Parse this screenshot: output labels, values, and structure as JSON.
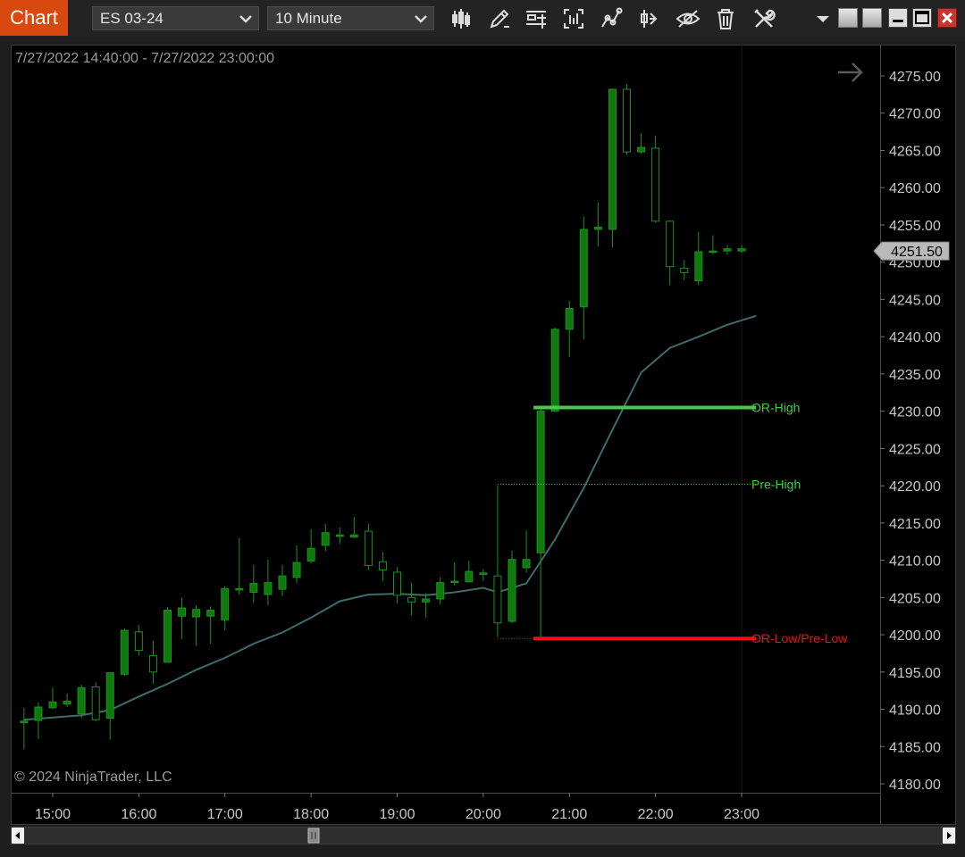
{
  "toolbar": {
    "tab_label": "Chart",
    "instrument": "ES 03-24",
    "interval": "10 Minute",
    "icons": [
      "bar-type-icon",
      "draw-pencil-icon",
      "properties-icon",
      "data-box-icon",
      "indicators-icon",
      "strategies-icon",
      "hide-drawings-icon",
      "remove-drawings-icon",
      "tools-icon",
      "dropdown-arrow-icon"
    ],
    "window_buttons": [
      "tile-icon",
      "tile2-icon",
      "minimize-icon",
      "maximize-icon",
      "close-icon"
    ]
  },
  "chart": {
    "date_range": "7/27/2022 14:40:00 - 7/27/2022 23:00:00",
    "copyright": "© 2024 NinjaTrader, LLC",
    "current_price_label": "4251.50"
  },
  "chart_data": {
    "type": "candlestick",
    "instrument": "ES 03-24",
    "interval": "10 Minute",
    "x_ticks": [
      "15:00",
      "16:00",
      "17:00",
      "18:00",
      "19:00",
      "20:00",
      "21:00",
      "22:00",
      "23:00"
    ],
    "y_ticks": [
      "4180.00",
      "4185.00",
      "4190.00",
      "4195.00",
      "4200.00",
      "4205.00",
      "4210.00",
      "4215.00",
      "4220.00",
      "4225.00",
      "4230.00",
      "4235.00",
      "4240.00",
      "4245.00",
      "4250.00",
      "4255.00",
      "4260.00",
      "4265.00",
      "4270.00",
      "4275.00"
    ],
    "ylim": [
      4179,
      4279
    ],
    "xlim_minutes": [
      860,
      1410
    ],
    "current_price": 4251.5,
    "candles": [
      {
        "t": 880,
        "o": 4188.2,
        "h": 4190.2,
        "l": 4184.6,
        "c": 4188.4
      },
      {
        "t": 890,
        "o": 4188.5,
        "h": 4190.9,
        "l": 4186.0,
        "c": 4190.3
      },
      {
        "t": 900,
        "o": 4190.2,
        "h": 4192.9,
        "l": 4190.0,
        "c": 4191.0
      },
      {
        "t": 910,
        "o": 4190.7,
        "h": 4192.1,
        "l": 4190.3,
        "c": 4191.1
      },
      {
        "t": 920,
        "o": 4189.4,
        "h": 4193.3,
        "l": 4188.8,
        "c": 4192.9
      },
      {
        "t": 930,
        "o": 4193.0,
        "h": 4193.6,
        "l": 4188.4,
        "c": 4188.6
      },
      {
        "t": 940,
        "o": 4188.8,
        "h": 4195.0,
        "l": 4185.9,
        "c": 4194.9
      },
      {
        "t": 950,
        "o": 4194.7,
        "h": 4200.8,
        "l": 4194.5,
        "c": 4200.6
      },
      {
        "t": 960,
        "o": 4200.4,
        "h": 4201.3,
        "l": 4197.2,
        "c": 4197.9
      },
      {
        "t": 970,
        "o": 4197.2,
        "h": 4199.2,
        "l": 4193.4,
        "c": 4195.0
      },
      {
        "t": 980,
        "o": 4196.3,
        "h": 4203.7,
        "l": 4196.3,
        "c": 4203.3
      },
      {
        "t": 990,
        "o": 4202.5,
        "h": 4205.0,
        "l": 4199.4,
        "c": 4203.6
      },
      {
        "t": 1000,
        "o": 4202.4,
        "h": 4204.0,
        "l": 4198.5,
        "c": 4203.4
      },
      {
        "t": 1010,
        "o": 4202.5,
        "h": 4203.8,
        "l": 4198.8,
        "c": 4203.3
      },
      {
        "t": 1020,
        "o": 4202.0,
        "h": 4206.5,
        "l": 4200.6,
        "c": 4206.2
      },
      {
        "t": 1030,
        "o": 4206.0,
        "h": 4213.0,
        "l": 4205.4,
        "c": 4206.2
      },
      {
        "t": 1040,
        "o": 4205.7,
        "h": 4209.4,
        "l": 4204.3,
        "c": 4206.9
      },
      {
        "t": 1050,
        "o": 4205.4,
        "h": 4210.1,
        "l": 4204.0,
        "c": 4207.0
      },
      {
        "t": 1060,
        "o": 4206.1,
        "h": 4209.4,
        "l": 4205.2,
        "c": 4207.9
      },
      {
        "t": 1070,
        "o": 4207.7,
        "h": 4212.0,
        "l": 4206.9,
        "c": 4209.7
      },
      {
        "t": 1080,
        "o": 4209.9,
        "h": 4214.2,
        "l": 4209.6,
        "c": 4211.6
      },
      {
        "t": 1090,
        "o": 4212.0,
        "h": 4214.9,
        "l": 4211.2,
        "c": 4213.7
      },
      {
        "t": 1100,
        "o": 4213.2,
        "h": 4214.4,
        "l": 4212.2,
        "c": 4213.4
      },
      {
        "t": 1110,
        "o": 4213.1,
        "h": 4215.8,
        "l": 4213.0,
        "c": 4213.4
      },
      {
        "t": 1120,
        "o": 4213.9,
        "h": 4214.9,
        "l": 4208.7,
        "c": 4209.3
      },
      {
        "t": 1130,
        "o": 4209.8,
        "h": 4211.1,
        "l": 4207.2,
        "c": 4208.7
      },
      {
        "t": 1140,
        "o": 4208.4,
        "h": 4209.1,
        "l": 4204.2,
        "c": 4205.3
      },
      {
        "t": 1150,
        "o": 4205.0,
        "h": 4207.0,
        "l": 4202.6,
        "c": 4204.4
      },
      {
        "t": 1160,
        "o": 4204.4,
        "h": 4205.6,
        "l": 4202.3,
        "c": 4204.8
      },
      {
        "t": 1170,
        "o": 4204.8,
        "h": 4207.7,
        "l": 4204.1,
        "c": 4207.0
      },
      {
        "t": 1180,
        "o": 4207.0,
        "h": 4209.7,
        "l": 4206.6,
        "c": 4207.2
      },
      {
        "t": 1190,
        "o": 4207.1,
        "h": 4209.9,
        "l": 4207.0,
        "c": 4208.5
      },
      {
        "t": 1200,
        "o": 4208.1,
        "h": 4208.8,
        "l": 4207.2,
        "c": 4208.3
      },
      {
        "t": 1210,
        "o": 4207.9,
        "h": 4220.0,
        "l": 4199.7,
        "c": 4201.6
      },
      {
        "t": 1220,
        "o": 4201.8,
        "h": 4211.3,
        "l": 4201.6,
        "c": 4210.1
      },
      {
        "t": 1230,
        "o": 4209.0,
        "h": 4214.0,
        "l": 4208.3,
        "c": 4210.1
      },
      {
        "t": 1240,
        "o": 4211.0,
        "h": 4230.6,
        "l": 4199.6,
        "c": 4230.0
      },
      {
        "t": 1250,
        "o": 4230.0,
        "h": 4241.2,
        "l": 4229.9,
        "c": 4241.0
      },
      {
        "t": 1260,
        "o": 4241.0,
        "h": 4244.8,
        "l": 4237.3,
        "c": 4243.8
      },
      {
        "t": 1270,
        "o": 4244.0,
        "h": 4256.1,
        "l": 4239.6,
        "c": 4254.4
      },
      {
        "t": 1280,
        "o": 4254.4,
        "h": 4258.0,
        "l": 4252.1,
        "c": 4254.7
      },
      {
        "t": 1290,
        "o": 4254.4,
        "h": 4273.3,
        "l": 4252.0,
        "c": 4273.2
      },
      {
        "t": 1300,
        "o": 4273.2,
        "h": 4273.9,
        "l": 4264.4,
        "c": 4264.8
      },
      {
        "t": 1310,
        "o": 4264.8,
        "h": 4267.3,
        "l": 4264.6,
        "c": 4265.4
      },
      {
        "t": 1320,
        "o": 4265.3,
        "h": 4267.0,
        "l": 4255.3,
        "c": 4255.5
      },
      {
        "t": 1330,
        "o": 4255.5,
        "h": 4255.6,
        "l": 4246.9,
        "c": 4249.4
      },
      {
        "t": 1340,
        "o": 4249.2,
        "h": 4250.3,
        "l": 4247.6,
        "c": 4248.6
      },
      {
        "t": 1350,
        "o": 4247.5,
        "h": 4254.1,
        "l": 4246.9,
        "c": 4251.4
      },
      {
        "t": 1360,
        "o": 4251.4,
        "h": 4253.6,
        "l": 4251.1,
        "c": 4251.5
      },
      {
        "t": 1370,
        "o": 4251.5,
        "h": 4252.3,
        "l": 4251.0,
        "c": 4251.8
      },
      {
        "t": 1380,
        "o": 4251.5,
        "h": 4252.3,
        "l": 4251.2,
        "c": 4251.8
      }
    ],
    "moving_average": [
      {
        "t": 880,
        "v": 4188.6
      },
      {
        "t": 900,
        "v": 4188.9
      },
      {
        "t": 920,
        "v": 4189.2
      },
      {
        "t": 940,
        "v": 4189.9
      },
      {
        "t": 960,
        "v": 4191.7
      },
      {
        "t": 980,
        "v": 4193.4
      },
      {
        "t": 1000,
        "v": 4195.3
      },
      {
        "t": 1020,
        "v": 4196.9
      },
      {
        "t": 1040,
        "v": 4198.8
      },
      {
        "t": 1060,
        "v": 4200.3
      },
      {
        "t": 1080,
        "v": 4202.3
      },
      {
        "t": 1100,
        "v": 4204.5
      },
      {
        "t": 1120,
        "v": 4205.4
      },
      {
        "t": 1140,
        "v": 4205.5
      },
      {
        "t": 1160,
        "v": 4205.3
      },
      {
        "t": 1180,
        "v": 4205.7
      },
      {
        "t": 1200,
        "v": 4206.3
      },
      {
        "t": 1210,
        "v": 4205.7
      },
      {
        "t": 1230,
        "v": 4206.9
      },
      {
        "t": 1250,
        "v": 4212.8
      },
      {
        "t": 1270,
        "v": 4219.7
      },
      {
        "t": 1290,
        "v": 4227.5
      },
      {
        "t": 1310,
        "v": 4235.2
      },
      {
        "t": 1330,
        "v": 4238.5
      },
      {
        "t": 1350,
        "v": 4240.0
      },
      {
        "t": 1370,
        "v": 4241.6
      },
      {
        "t": 1390,
        "v": 4242.8
      }
    ],
    "levels": [
      {
        "name": "OR-High",
        "price": 4230.5,
        "from": 1235,
        "to": 1390,
        "style": "solid",
        "color": "#44cc44"
      },
      {
        "name": "Pre-High",
        "price": 4220.2,
        "from": 1210,
        "to": 1390,
        "style": "dotted",
        "color": "#44cc44"
      },
      {
        "name": "OR-Low/Pre-Low",
        "price": 4199.5,
        "from": 1235,
        "to": 1390,
        "style": "solid",
        "color": "#ee1111"
      },
      {
        "name": "",
        "price": 4199.5,
        "from": 1210,
        "to": 1235,
        "style": "dotted",
        "color": "#ee1111"
      }
    ],
    "colors": {
      "up": "#0e7a0e",
      "down": "#000000",
      "wick": "#1f8f1f",
      "ma": "#3f6b6b",
      "grid": "#2a2a2a"
    }
  }
}
